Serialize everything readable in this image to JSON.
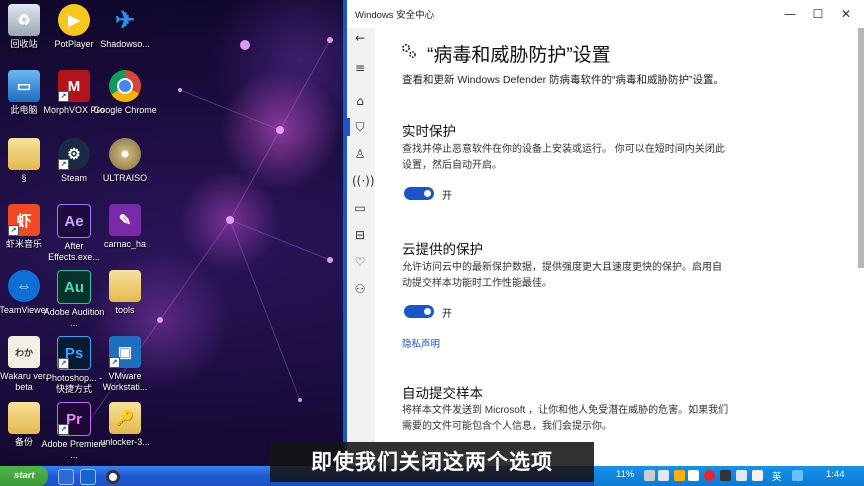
{
  "desktop_icons": [
    {
      "label": "回收站",
      "icon": "recycle-bin-icon"
    },
    {
      "label": "PotPlayer",
      "icon": "potplayer-icon"
    },
    {
      "label": "Shadowso...",
      "icon": "shadowsocks-icon"
    },
    {
      "label": "此电脑",
      "icon": "computer-icon"
    },
    {
      "label": "MorphVOX Pro",
      "icon": "morphvox-icon"
    },
    {
      "label": "Google Chrome",
      "icon": "chrome-icon"
    },
    {
      "label": "§",
      "icon": "folder-icon"
    },
    {
      "label": "Steam",
      "icon": "steam-icon"
    },
    {
      "label": "ULTRAISO",
      "icon": "ultraiso-icon"
    },
    {
      "label": "虾米音乐",
      "icon": "xiami-icon"
    },
    {
      "label": "After Effects.exe...",
      "icon": "after-effects-icon"
    },
    {
      "label": "carnac_ha",
      "icon": "carnac-icon"
    },
    {
      "label": "TeamViewer",
      "icon": "teamviewer-icon"
    },
    {
      "label": "Adobe Audition ...",
      "icon": "audition-icon"
    },
    {
      "label": "tools",
      "icon": "folder-icon"
    },
    {
      "label": "Wakaru ver. beta",
      "icon": "wakaru-icon"
    },
    {
      "label": "Photoshop... - 快捷方式",
      "icon": "photoshop-icon"
    },
    {
      "label": "VMware Workstati...",
      "icon": "vmware-icon"
    },
    {
      "label": "备份",
      "icon": "folder-icon"
    },
    {
      "label": "Adobe Premiere ...",
      "icon": "premiere-icon"
    },
    {
      "label": "unlocker-3...",
      "icon": "unlocker-icon"
    }
  ],
  "window": {
    "title": "Windows 安全中心",
    "controls": {
      "minimize": "—",
      "maximize": "☐",
      "close": "✕"
    },
    "page_title": "“病毒和威胁防护”设置",
    "subtitle": "查看和更新 Windows Defender 防病毒软件的“病毒和威胁防护”设置。",
    "sections": [
      {
        "heading": "实时保护",
        "desc_line1": "查找并停止恶意软件在你的设备上安装或运行。 你可以在短时间内关闭此",
        "desc_line2": "设置，然后自动开启。",
        "toggle": "开"
      },
      {
        "heading": "云提供的保护",
        "desc_line1": "允许访问云中的最新保护数据，提供强度更大且速度更快的保护。启用自",
        "desc_line2": "动提交样本功能时工作性能最佳。",
        "toggle": "开",
        "link": "隐私声明"
      },
      {
        "heading": "自动提交样本",
        "desc_line1": "将样本文件发送到 Microsoft ，让你和他人免受潜在威胁的危害。如果我们",
        "desc_line2": "需要的文件可能包含个人信息，我们会提示你。"
      }
    ]
  },
  "taskbar": {
    "start_label": "start",
    "cpu": "11%",
    "ime": "英",
    "time": "1:44"
  },
  "caption": "即使我们关闭这两个选项",
  "colors": {
    "accent": "#1a56c9",
    "toggle_on": "#1a56c9"
  }
}
